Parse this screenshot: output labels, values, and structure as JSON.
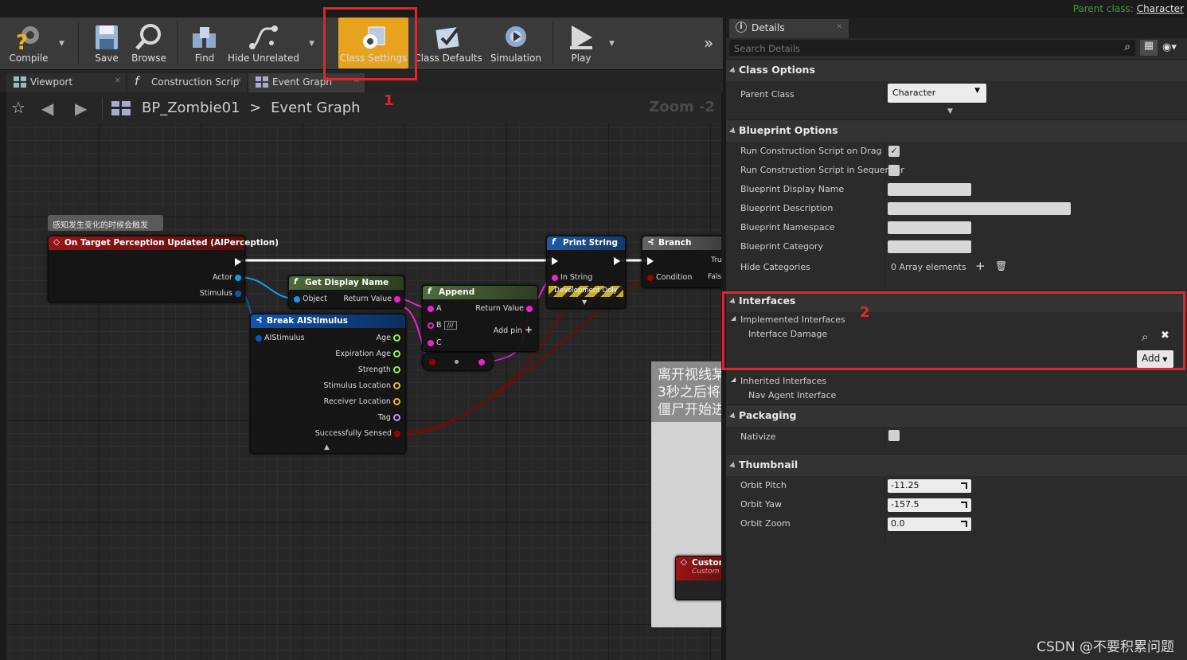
{
  "topbar": {
    "parent_class_label": "Parent class:",
    "parent_class_value": "Character"
  },
  "toolbar": {
    "compile": "Compile",
    "save": "Save",
    "browse": "Browse",
    "find": "Find",
    "hide_unrelated": "Hide Unrelated",
    "class_settings": "Class Settings",
    "class_defaults": "Class Defaults",
    "simulation": "Simulation",
    "play": "Play"
  },
  "tabs": [
    {
      "label": "Viewport"
    },
    {
      "label": "Construction Scrip"
    },
    {
      "label": "Event Graph"
    }
  ],
  "nav": {
    "crumb_root": "BP_Zombie01",
    "crumb_sep": ">",
    "crumb_leaf": "Event Graph",
    "zoom": "Zoom -2"
  },
  "annotations": {
    "marker1": "1",
    "marker2": "2"
  },
  "graph": {
    "comment": "感知发生变化的时候会触发",
    "event_node": {
      "title": "On Target Perception Updated (AIPerception)",
      "pin_actor": "Actor",
      "pin_stimulus": "Stimulus"
    },
    "get_display_name": {
      "title": "Get Display Name",
      "pin_object": "Object",
      "pin_return": "Return Value"
    },
    "break_stimulus": {
      "title": "Break AIStimulus",
      "pin_in": "AIStimulus",
      "pins": [
        "Age",
        "Expiration Age",
        "Strength",
        "Stimulus Location",
        "Receiver Location",
        "Tag",
        "Successfully Sensed"
      ]
    },
    "append": {
      "title": "Append",
      "pin_a": "A",
      "pin_b": "B",
      "pin_c": "C",
      "pin_b_value": "///",
      "return": "Return Value",
      "add_pin": "Add pin"
    },
    "print_string": {
      "title": "Print String",
      "in_string": "In String",
      "dev_only": "Development Only"
    },
    "branch": {
      "title": "Branch",
      "true": "Tru",
      "condition": "Condition",
      "false": "Fals"
    },
    "note": [
      "离开视线某",
      "3秒之后将",
      "僵尸开始进"
    ],
    "custom_event": {
      "title": "Custom",
      "sub": "Custom"
    }
  },
  "details": {
    "tab_label": "Details",
    "search_placeholder": "Search Details",
    "class_options": {
      "header": "Class Options",
      "parent_class_label": "Parent Class",
      "parent_class_value": "Character"
    },
    "blueprint_options": {
      "header": "Blueprint Options",
      "run_construction_on_drag": {
        "label": "Run Construction Script on Drag",
        "checked": true
      },
      "run_construction_in_sequencer": {
        "label": "Run Construction Script in Sequencer",
        "checked": false
      },
      "display_name": {
        "label": "Blueprint Display Name",
        "value": ""
      },
      "description": {
        "label": "Blueprint Description",
        "value": ""
      },
      "namespace": {
        "label": "Blueprint Namespace",
        "value": ""
      },
      "category": {
        "label": "Blueprint Category",
        "value": ""
      },
      "hide_categories": {
        "label": "Hide Categories",
        "value": "0 Array elements"
      }
    },
    "interfaces": {
      "header": "Interfaces",
      "implemented_label": "Implemented Interfaces",
      "implemented": [
        "Interface Damage"
      ],
      "add_button": "Add",
      "inherited_label": "Inherited Interfaces",
      "inherited": [
        "Nav Agent Interface"
      ]
    },
    "packaging": {
      "header": "Packaging",
      "nativize_label": "Nativize",
      "nativize_checked": false
    },
    "thumbnail": {
      "header": "Thumbnail",
      "orbit_pitch": {
        "label": "Orbit Pitch",
        "value": "-11.25"
      },
      "orbit_yaw": {
        "label": "Orbit Yaw",
        "value": "-157.5"
      },
      "orbit_zoom": {
        "label": "Orbit Zoom",
        "value": "0.0"
      }
    }
  },
  "watermark": "CSDN @不要积累问题",
  "colors": {
    "highlight_red": "#e0262c",
    "class_settings_bg": "#e8a31e",
    "exec_white": "#ffffff",
    "string_pink": "#f01fd6",
    "object_blue": "#1797f0",
    "bool_red": "#9a0000",
    "struct_blue": "#0d55b5"
  }
}
